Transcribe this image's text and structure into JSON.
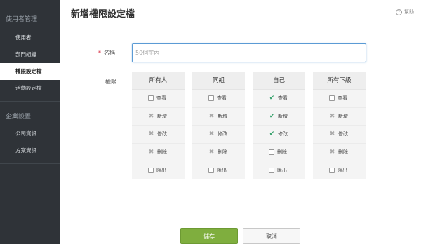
{
  "sidebar": {
    "group1": "使用者管理",
    "group1_items": [
      "使用者",
      "部門組織",
      "權限設定檔",
      "活動設定檔"
    ],
    "active_index": 2,
    "group2": "企業設置",
    "group2_items": [
      "公司資訊",
      "方案資訊"
    ]
  },
  "header": {
    "title": "新增權限設定檔",
    "help_label": "幫助",
    "help_icon": "question-circle-icon"
  },
  "form": {
    "required_mark": "*",
    "name_label": "名稱",
    "name_value": "",
    "name_placeholder": "50個字內",
    "permission_label": "權限",
    "columns": [
      {
        "title": "所有人",
        "options": [
          {
            "label": "查看",
            "state": "unchecked"
          },
          {
            "label": "新增",
            "state": "disabled"
          },
          {
            "label": "修改",
            "state": "disabled"
          },
          {
            "label": "刪除",
            "state": "disabled"
          },
          {
            "label": "匯出",
            "state": "unchecked"
          }
        ]
      },
      {
        "title": "同組",
        "options": [
          {
            "label": "查看",
            "state": "unchecked"
          },
          {
            "label": "新增",
            "state": "disabled"
          },
          {
            "label": "修改",
            "state": "disabled"
          },
          {
            "label": "刪除",
            "state": "disabled"
          },
          {
            "label": "匯出",
            "state": "unchecked"
          }
        ]
      },
      {
        "title": "自己",
        "options": [
          {
            "label": "查看",
            "state": "checked"
          },
          {
            "label": "新增",
            "state": "checked"
          },
          {
            "label": "修改",
            "state": "checked"
          },
          {
            "label": "刪除",
            "state": "unchecked"
          },
          {
            "label": "匯出",
            "state": "unchecked"
          }
        ]
      },
      {
        "title": "所有下級",
        "options": [
          {
            "label": "查看",
            "state": "unchecked"
          },
          {
            "label": "新增",
            "state": "disabled"
          },
          {
            "label": "修改",
            "state": "disabled"
          },
          {
            "label": "刪除",
            "state": "disabled"
          },
          {
            "label": "匯出",
            "state": "unchecked"
          }
        ]
      }
    ]
  },
  "footer": {
    "save_label": "儲存",
    "cancel_label": "取消"
  },
  "colors": {
    "sidebar_bg": "#2f3338",
    "accent_green": "#7fae3e",
    "check_green": "#34a06a",
    "input_focus": "#5b9bd5",
    "required_red": "#d0021b"
  }
}
